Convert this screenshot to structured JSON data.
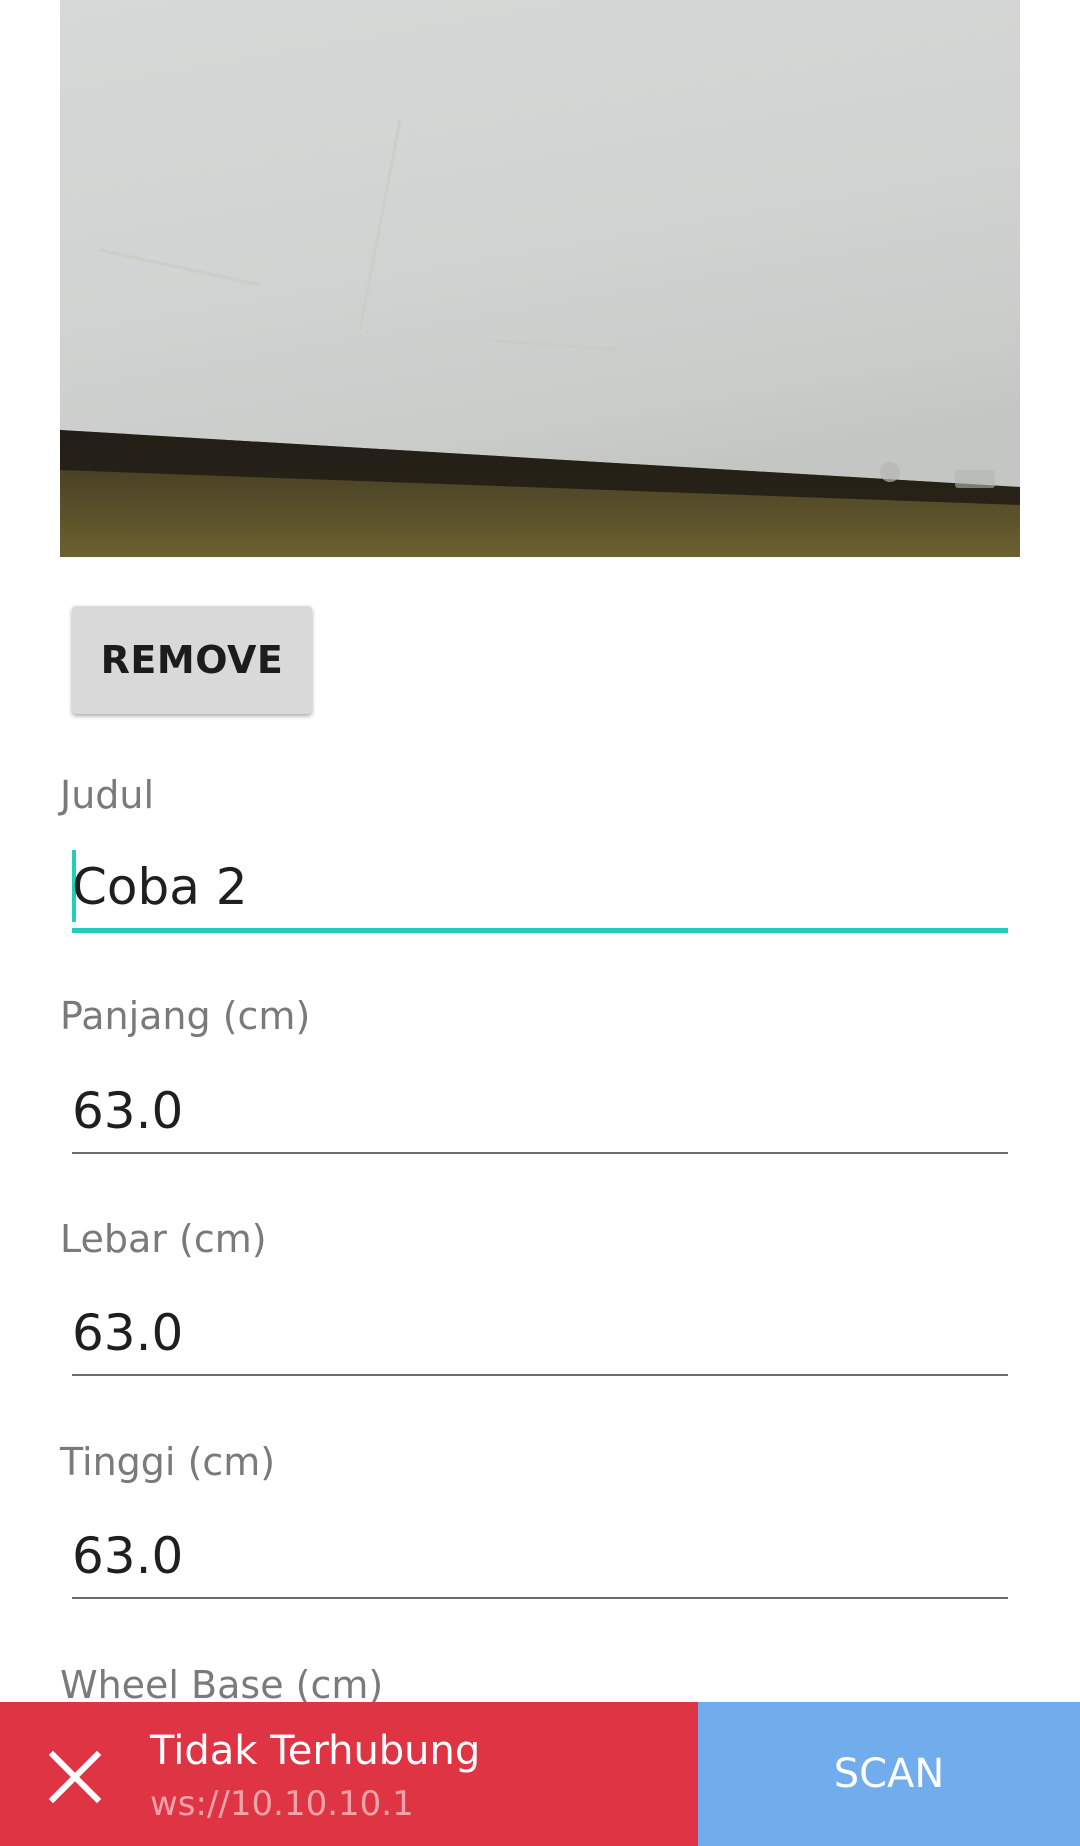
{
  "remove_button": {
    "label": "REMOVE"
  },
  "form": {
    "fields": [
      {
        "label": "Judul",
        "value": "Coba 2"
      },
      {
        "label": "Panjang (cm)",
        "value": "63.0"
      },
      {
        "label": "Lebar (cm)",
        "value": "63.0"
      },
      {
        "label": "Tinggi (cm)",
        "value": "63.0"
      },
      {
        "label": "Wheel Base (cm)",
        "value": ""
      }
    ]
  },
  "status_bar": {
    "title": "Tidak Terhubung",
    "address": "ws://10.10.10.1",
    "icon": "close-icon",
    "color": "#de3444"
  },
  "scan_button": {
    "label": "SCAN",
    "color": "#71aced"
  },
  "accent_color": "#1fcfbc"
}
